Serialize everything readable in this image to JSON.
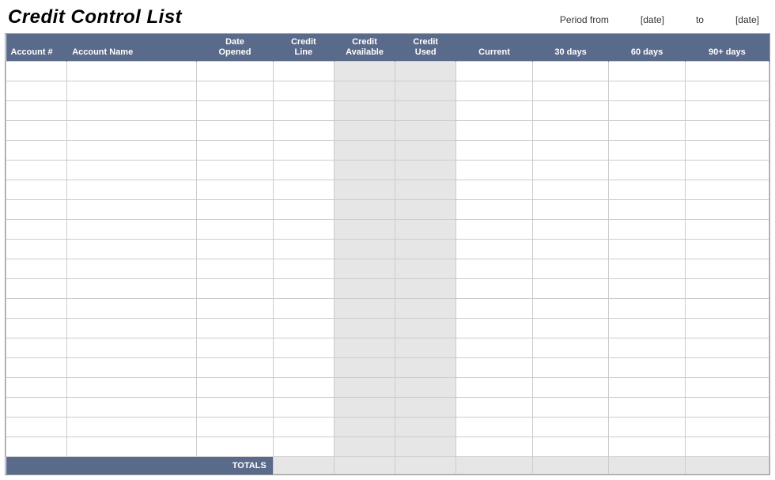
{
  "header": {
    "title": "Credit Control List",
    "period_from_label": "Period from",
    "period_from_value": "[date]",
    "period_to_label": "to",
    "period_to_value": "[date]"
  },
  "columns": {
    "account_num": "Account #",
    "account_name": "Account Name",
    "date_opened": "Date\nOpened",
    "credit_line": "Credit\nLine",
    "credit_available": "Credit\nAvailable",
    "credit_used": "Credit\nUsed",
    "current": "Current",
    "days30": "30 days",
    "days60": "60 days",
    "days90": "90+ days"
  },
  "rows": [
    {},
    {},
    {},
    {},
    {},
    {},
    {},
    {},
    {},
    {},
    {},
    {},
    {},
    {},
    {},
    {},
    {},
    {},
    {},
    {}
  ],
  "footer": {
    "totals_label": "TOTALS",
    "credit_line": "",
    "credit_available": "",
    "credit_used": "",
    "current": "",
    "days30": "",
    "days60": "",
    "days90": ""
  }
}
